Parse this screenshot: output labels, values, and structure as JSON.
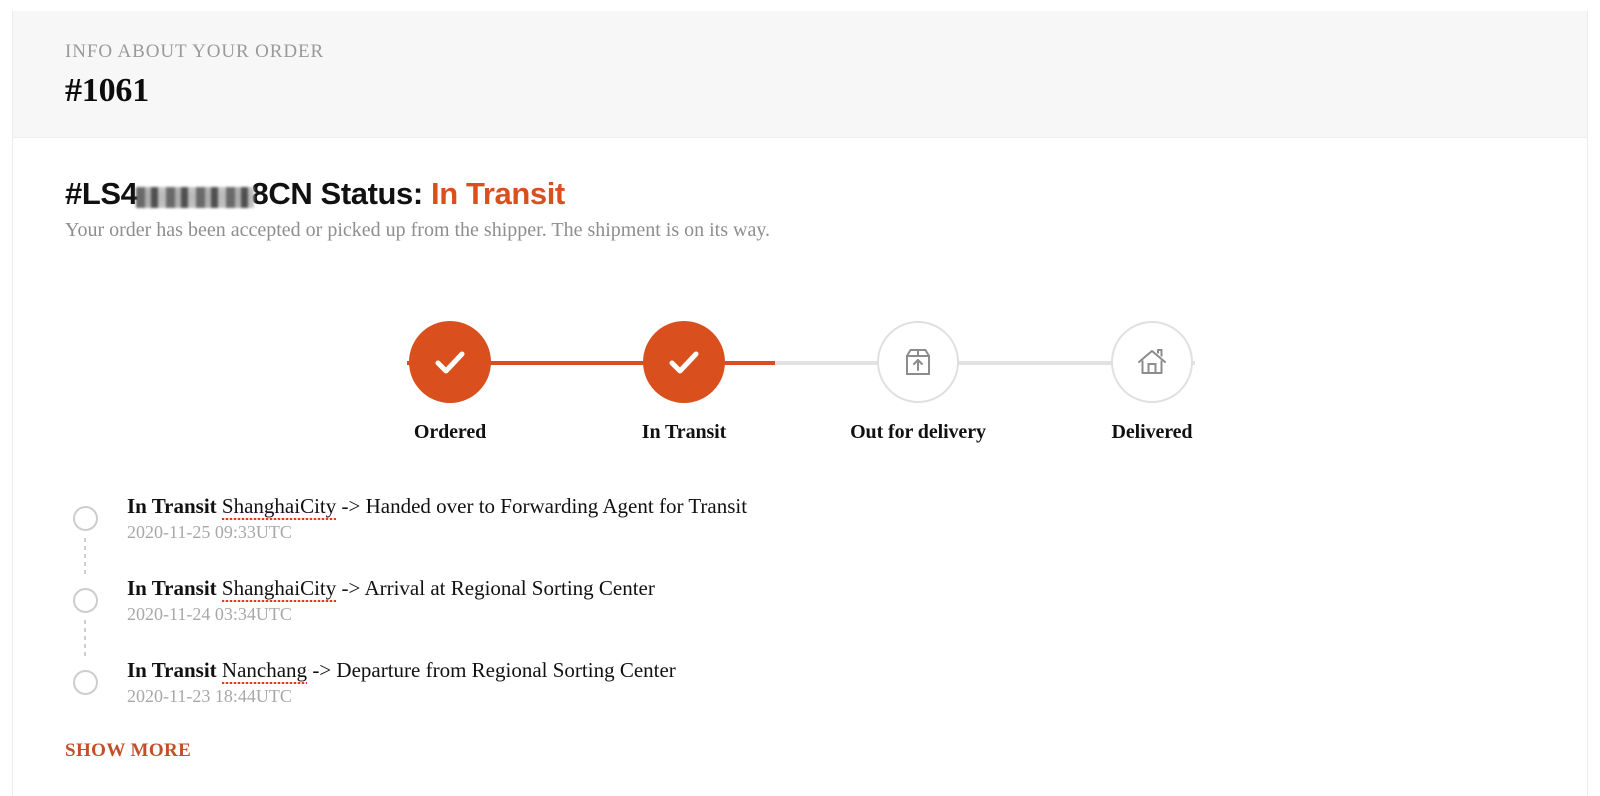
{
  "header": {
    "eyebrow": "INFO ABOUT YOUR ORDER",
    "order_number": "#1061"
  },
  "status": {
    "tracking_prefix": "#LS4",
    "tracking_suffix": "8CN",
    "tracking_redacted": true,
    "label": " Status: ",
    "value": "In Transit",
    "description": "Your order has been accepted or picked up from the shipper. The shipment is on its way.",
    "accent_color": "#d9501e"
  },
  "stepper": {
    "steps": [
      {
        "label": "Ordered",
        "state": "done",
        "icon": "check-icon"
      },
      {
        "label": "In Transit",
        "state": "done",
        "icon": "check-icon"
      },
      {
        "label": "Out for delivery",
        "state": "pending",
        "icon": "package-up-icon"
      },
      {
        "label": "Delivered",
        "state": "pending",
        "icon": "house-icon"
      }
    ],
    "progress_percent": 40,
    "done_color": "#d9501e",
    "pending_color": "#e0e0e0"
  },
  "history": {
    "items": [
      {
        "status": "In Transit",
        "place": "ShanghaiCity",
        "detail": "-> Handed over to Forwarding Agent for Transit",
        "timestamp": "2020-11-25 09:33UTC"
      },
      {
        "status": "In Transit",
        "place": "ShanghaiCity",
        "detail": "-> Arrival at Regional Sorting Center",
        "timestamp": "2020-11-24 03:34UTC"
      },
      {
        "status": "In Transit",
        "place": "Nanchang",
        "detail": "-> Departure from Regional Sorting Center",
        "timestamp": "2020-11-23 18:44UTC"
      }
    ]
  },
  "show_more_label": "SHOW MORE"
}
